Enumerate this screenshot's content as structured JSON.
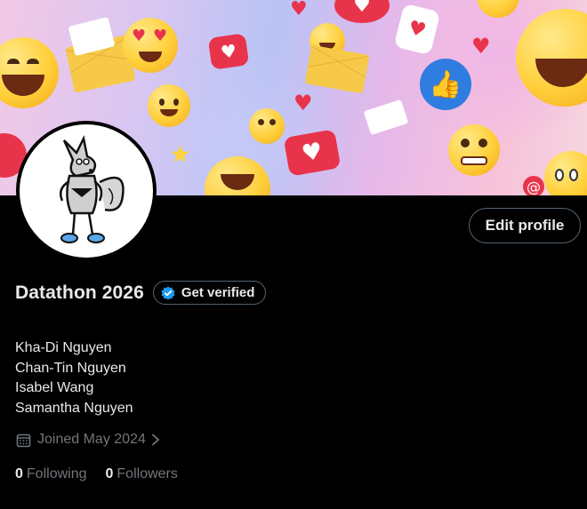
{
  "profile": {
    "display_name": "Datathon 2026",
    "verify_label": "Get verified",
    "edit_label": "Edit profile",
    "bio_lines": [
      "Kha-Di Nguyen",
      "Chan-Tin Nguyen",
      "Isabel Wang",
      "Samantha Nguyen"
    ],
    "joined": "Joined May 2024",
    "following_count": "0",
    "following_label": "Following",
    "followers_count": "0",
    "followers_label": "Followers"
  },
  "icons": {
    "verify": "blue-check-badge-icon",
    "calendar": "calendar-icon",
    "chevron": "chevron-right-icon"
  },
  "colors": {
    "background": "#000000",
    "text": "#e7e9ea",
    "muted": "#71767b",
    "border": "#536471",
    "verify_blue": "#1d9bf0"
  }
}
